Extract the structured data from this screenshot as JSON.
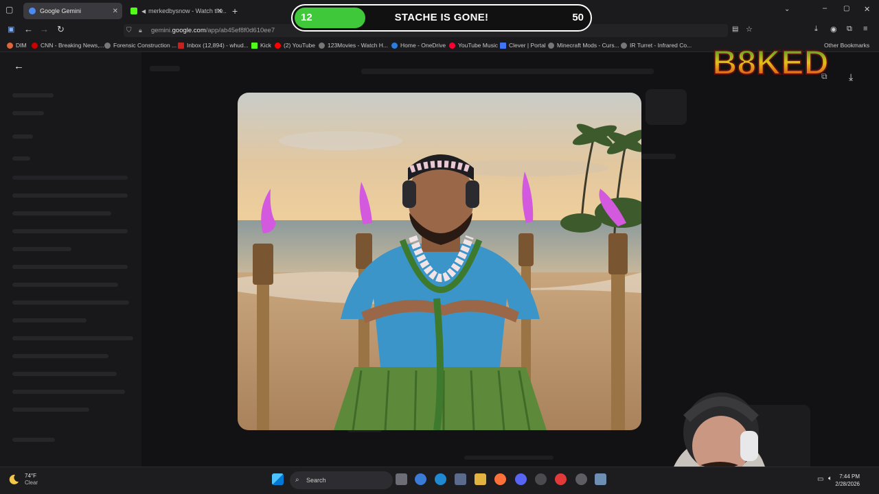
{
  "browser": {
    "tabs": [
      {
        "label": "Google Gemini",
        "color": "#4c8bf5"
      },
      {
        "label": "merkedbysnow - Watch the...",
        "color": "#53fc18"
      }
    ],
    "url_prefix": "gemini.",
    "url_domain": "google.com",
    "url_path": "/app/ab45ef8f0d610ee7",
    "new_tab": "+"
  },
  "bookmarks": [
    {
      "label": "DIM",
      "color": "#e0653a"
    },
    {
      "label": "CNN - Breaking News,...",
      "color": "#cc0000"
    },
    {
      "label": "Forensic Construction ...",
      "color": "#888888"
    },
    {
      "label": "Inbox (12,894) - whud...",
      "color": "#c5221f"
    },
    {
      "label": "Kick",
      "color": "#53fc18"
    },
    {
      "label": "(2) YouTube",
      "color": "#ff0000"
    },
    {
      "label": "123Movies - Watch H...",
      "color": "#888888"
    },
    {
      "label": "Home - OneDrive",
      "color": "#2a7de1"
    },
    {
      "label": "YouTube Music",
      "color": "#ff0033"
    },
    {
      "label": "Clever | Portal",
      "color": "#4274f6"
    },
    {
      "label": "Minecraft Mods - Curs...",
      "color": "#888888"
    },
    {
      "label": "IR Turret - Infrared Co...",
      "color": "#888888"
    },
    {
      "label": "Other Bookmarks",
      "color": "#888888"
    }
  ],
  "overlay": {
    "current": "12",
    "goal": "50",
    "progress": 0.24,
    "title": "STACHE IS GONE!",
    "fill_color": "#3ec83a"
  },
  "logo": {
    "text": "B8KED"
  },
  "taskbar": {
    "weather_temp": "74°F",
    "weather_cond": "Clear",
    "search_label": "Search",
    "time": "7:44 PM",
    "date": "2/28/2026"
  },
  "icons": {
    "back": "arrow-left-icon",
    "forward": "arrow-right-icon",
    "reload": "reload-icon",
    "download": "download-icon"
  }
}
